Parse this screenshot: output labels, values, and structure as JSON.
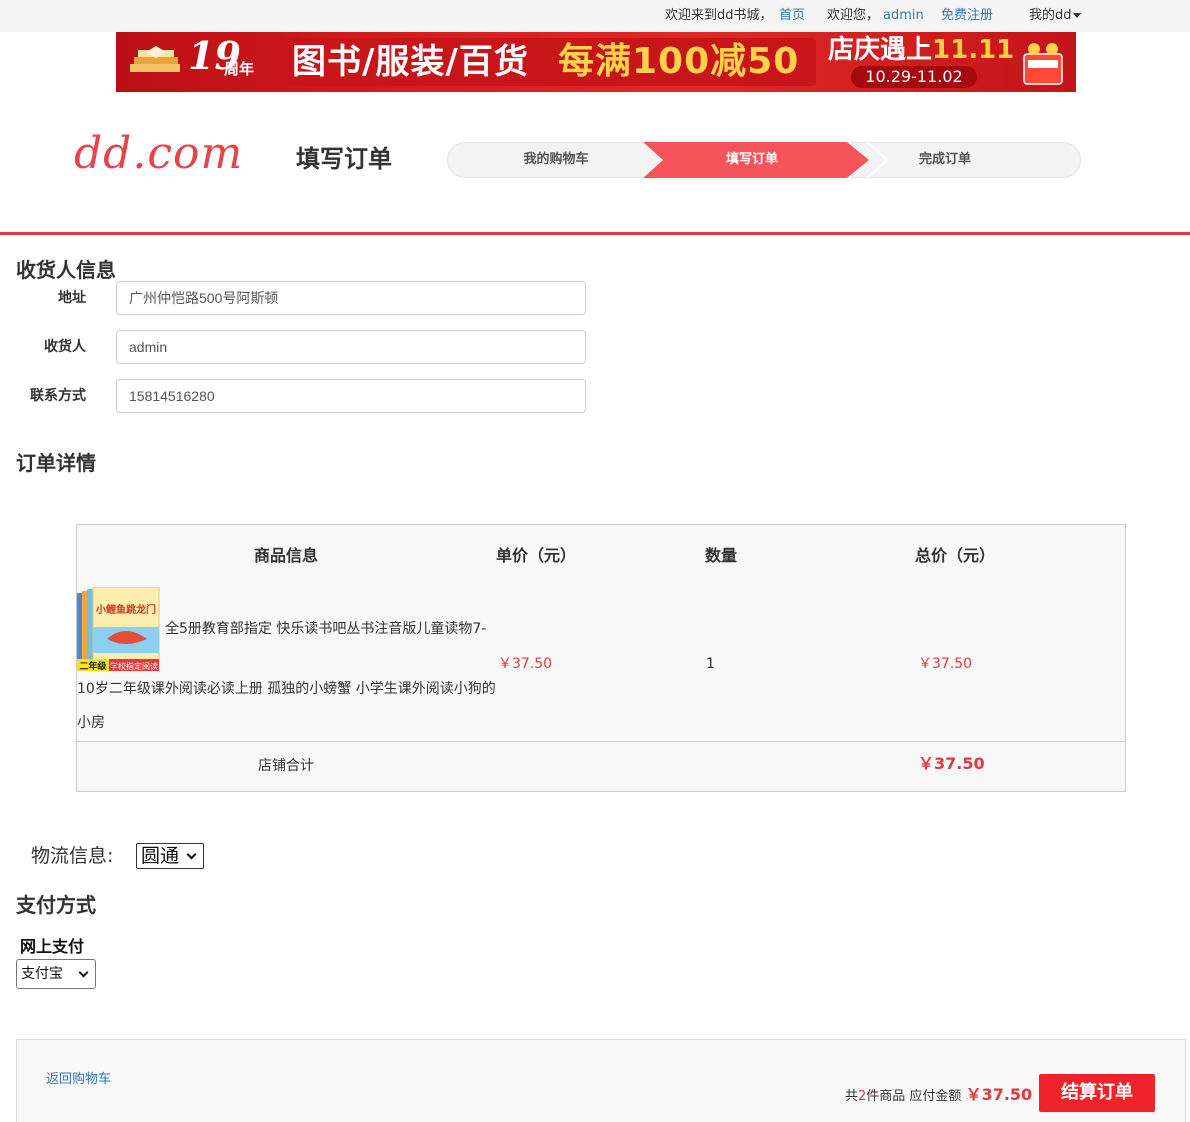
{
  "topbar": {
    "welcome": "欢迎来到dd书城，",
    "home_link": "首页",
    "greeting": "欢迎您，",
    "username": "admin",
    "register_link": "免费注册",
    "my_dd": "我的dd"
  },
  "banner": {
    "anniversary_number": "19",
    "anniversary_suffix": "周年",
    "categories": "图书/服装/百货",
    "promo": "每满100减50",
    "festival": "店庆遇上",
    "festival_date_mark": "11.11",
    "date_range": "10.29-11.02"
  },
  "header": {
    "logo": "dd.com",
    "page_title": "填写订单",
    "steps": [
      "我的购物车",
      "填写订单",
      "完成订单"
    ],
    "active_step": 1
  },
  "receiver": {
    "section_title": "收货人信息",
    "address_label": "地址",
    "address_value": "广州仲恺路500号阿斯顿",
    "name_label": "收货人",
    "name_value": "admin",
    "phone_label": "联系方式",
    "phone_value": "15814516280"
  },
  "order": {
    "section_title": "订单详情",
    "headers": [
      "商品信息",
      "单价（元）",
      "数量",
      "总价（元）"
    ],
    "item": {
      "title_line1": "全5册教育部指定 快乐读书吧丛书注音版儿童读物7-",
      "title_line2": "10岁二年级课外阅读必读上册 孤独的小螃蟹 小学生课外阅读小狗的",
      "title_line3": "小房",
      "cover_text": "小鲤鱼跳龙门",
      "cover_grade": "二年级",
      "cover_tag": "学校指定阅读",
      "unit_price": "￥37.50",
      "quantity": "1",
      "total_price": "￥37.50"
    },
    "shop_total_label": "店铺合计",
    "shop_total": "￥37.50"
  },
  "shipping": {
    "label": "物流信息:",
    "selected": "圆通"
  },
  "payment": {
    "section_title": "支付方式",
    "online_label": "网上支付",
    "selected": "支付宝"
  },
  "footer": {
    "back_link": "返回购物车",
    "summary_prefix": "共",
    "item_count": "2",
    "summary_mid": "件商品 应付金额",
    "amount": "￥37.50",
    "checkout_button": "结算订单"
  },
  "colors": {
    "accent_red": "#e4393c",
    "step_active": "#f5555a",
    "link_blue": "#3377b5",
    "checkout_red": "#f0222a"
  }
}
